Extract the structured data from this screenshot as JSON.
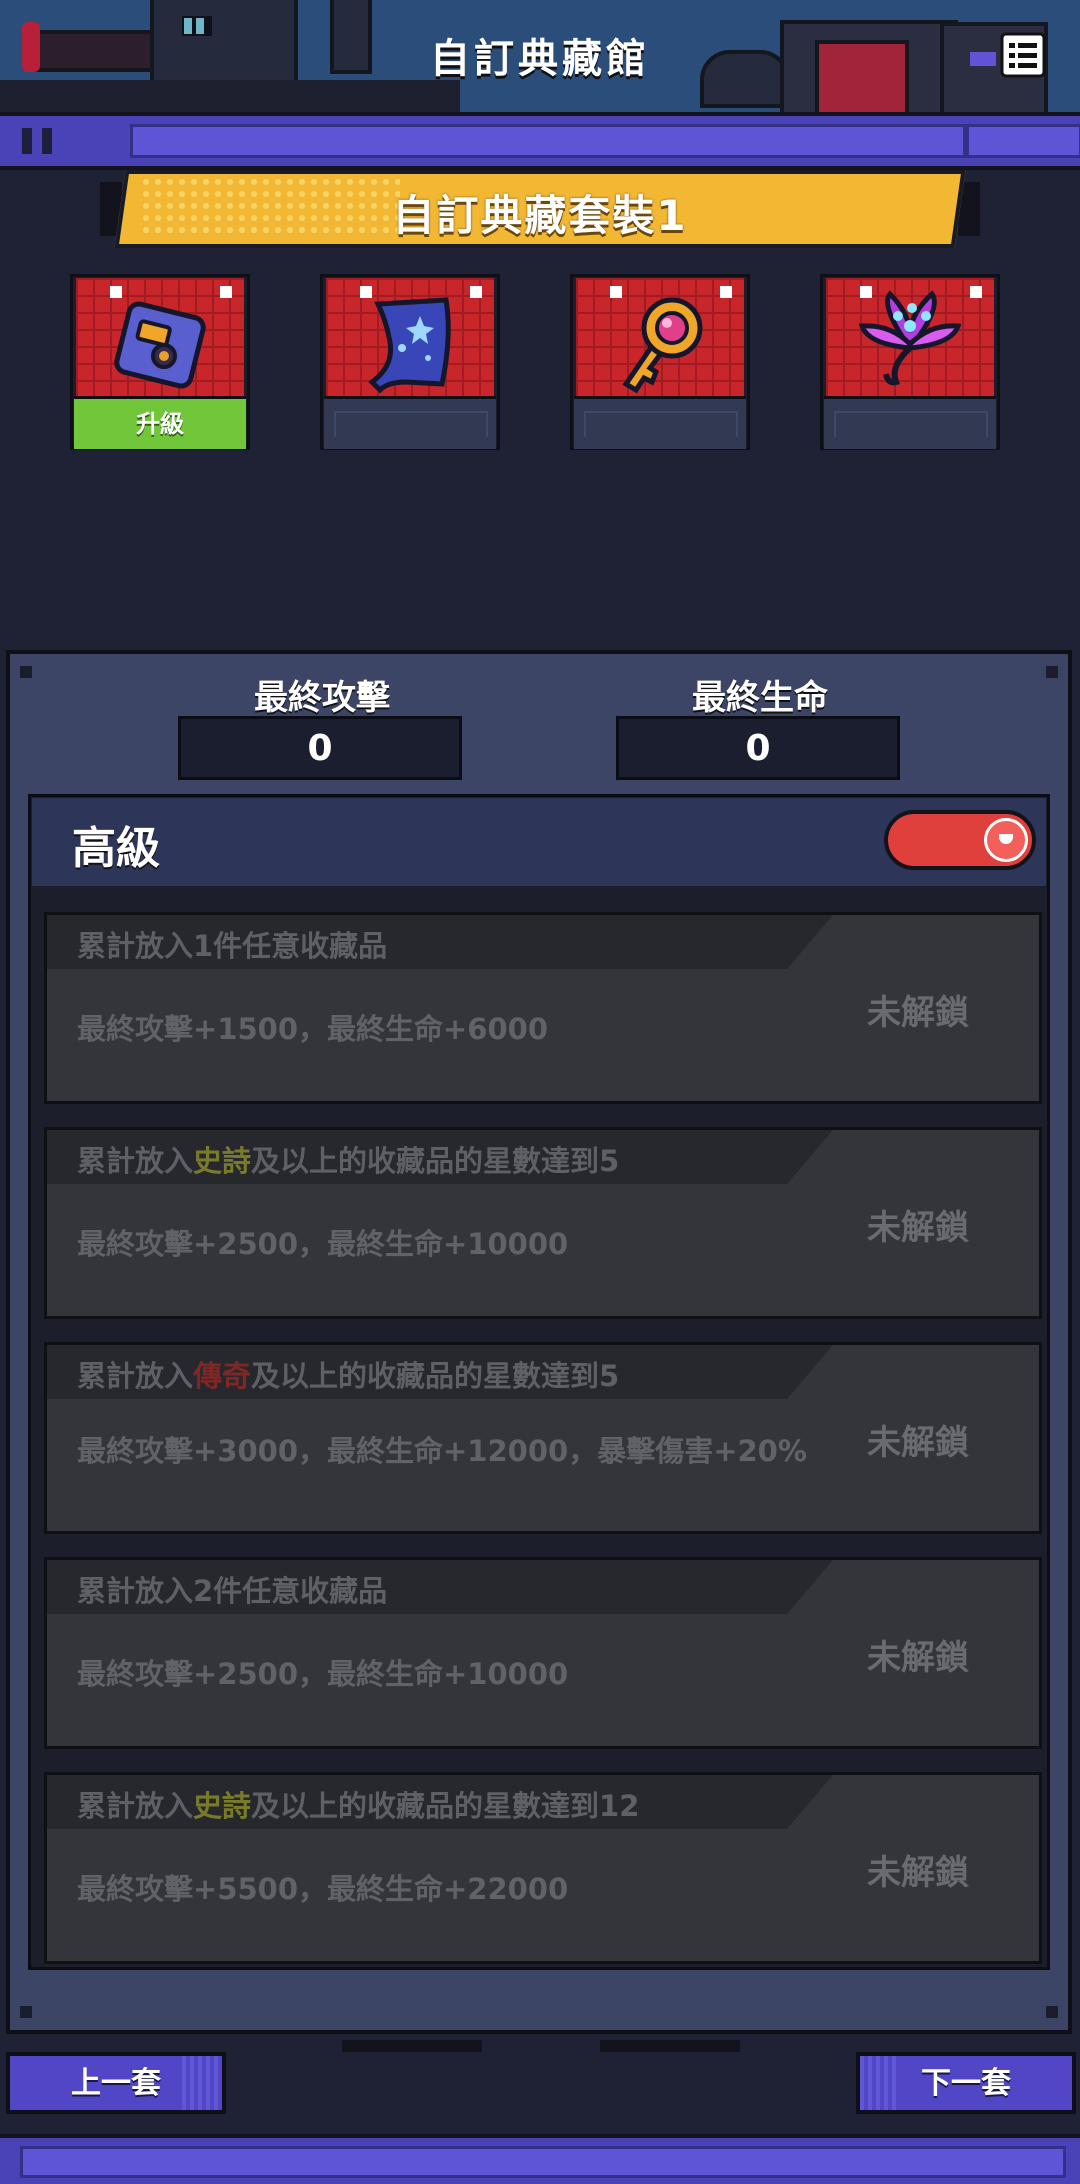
{
  "header": {
    "title": "自訂典藏館",
    "menu_icon": "list-menu-icon"
  },
  "collection_set": {
    "title": "自訂典藏套裝1",
    "slots": [
      {
        "icon": "pager-device-icon",
        "button_label": "升級"
      },
      {
        "icon": "star-cloak-icon"
      },
      {
        "icon": "magic-key-icon"
      },
      {
        "icon": "glowing-flower-icon"
      }
    ]
  },
  "stats": {
    "attack": {
      "label": "最終攻擊",
      "value": "0"
    },
    "hp": {
      "label": "最終生命",
      "value": "0"
    }
  },
  "advanced": {
    "title": "高級",
    "toggle_icon": "toggle-switch-icon",
    "toggle_on": true,
    "bonuses": [
      {
        "cond_pre": "累計放入1件任意收藏品",
        "reward": "最終攻擊+1500，最終生命+6000",
        "status": "未解鎖"
      },
      {
        "cond_pre": "累計放入",
        "rarity": "史詩",
        "cond_post": "及以上的收藏品的星數達到5",
        "reward": "最終攻擊+2500，最終生命+10000",
        "status": "未解鎖"
      },
      {
        "cond_pre": "累計放入",
        "rarity": "傳奇",
        "cond_post": "及以上的收藏品的星數達到5",
        "reward": "最終攻擊+3000，最終生命+12000，暴擊傷害+20%",
        "status": "未解鎖"
      },
      {
        "cond_pre": "累計放入2件任意收藏品",
        "reward": "最終攻擊+2500，最終生命+10000",
        "status": "未解鎖"
      },
      {
        "cond_pre": "累計放入",
        "rarity": "史詩",
        "cond_post": "及以上的收藏品的星數達到12",
        "reward": "最終攻擊+5500，最終生命+22000",
        "status": "未解鎖"
      }
    ]
  },
  "nav": {
    "prev_label": "上一套",
    "next_label": "下一套"
  },
  "colors": {
    "background": "#1f2135",
    "accent_purple": "#4a43b8",
    "ribbon_gold": "#f2b733",
    "upgrade_green": "#72c63a",
    "toggle_red": "#e0403c",
    "epic_text": "#7a7a2b",
    "legend_text": "#7f2626"
  }
}
